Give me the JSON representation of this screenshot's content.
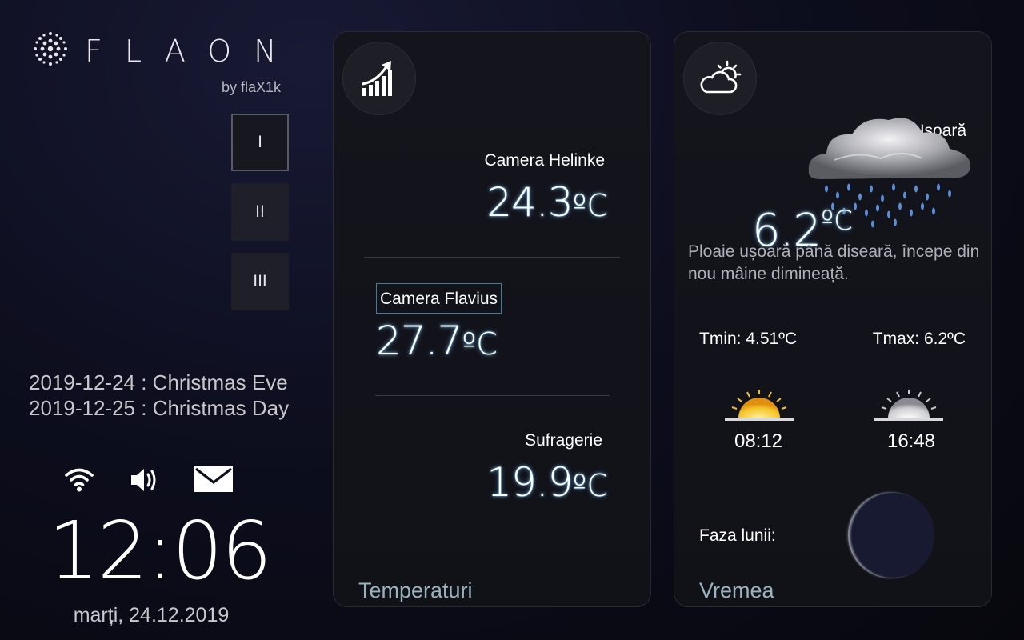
{
  "brand": {
    "name": "FLAON",
    "byline": "by flaX1k"
  },
  "pages": [
    {
      "label": "I",
      "active": true
    },
    {
      "label": "II",
      "active": false
    },
    {
      "label": "III",
      "active": false
    }
  ],
  "events": [
    "2019-12-24 : Christmas Eve",
    "2019-12-25 : Christmas Day"
  ],
  "status_icons": [
    "wifi-icon",
    "speaker-icon",
    "mail-icon"
  ],
  "clock": {
    "time": "12:06",
    "date": "marți, 24.12.2019"
  },
  "temperatures": {
    "icon": "trend-up-chart-icon",
    "footer": "Temperaturi",
    "unit": "ºC",
    "rooms": [
      {
        "name": "Camera Helinke",
        "value": "24.3"
      },
      {
        "name": "Camera Flavius",
        "value": "27.7"
      },
      {
        "name": "Sufragerie",
        "value": "19.9"
      }
    ]
  },
  "weather": {
    "icon": "partly-cloudy-icon",
    "footer": "Vremea",
    "condition": "Ploaie Ușoară",
    "condition_icon": "rain-cloud-icon",
    "temp_value": "6.2",
    "temp_unit": "ºC",
    "description": "Ploaie ușoară până diseară, începe din nou mâine dimineață.",
    "tmin": "Tmin: 4.51ºC",
    "tmax": "Tmax: 6.2ºC",
    "sunrise": "08:12",
    "sunset": "16:48",
    "moon_label": "Faza lunii:",
    "colors": {
      "accent_glow": "#78c8ff",
      "footer": "#9ab3bc",
      "selection_border": "#3b7f9f"
    }
  }
}
